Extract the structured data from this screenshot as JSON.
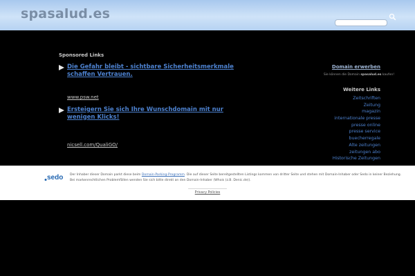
{
  "header": {
    "site_title": "spasalud.es",
    "search": {
      "value": "",
      "placeholder": ""
    }
  },
  "ads": {
    "title": "Sponsored Links",
    "items": [
      {
        "headline": "Die Gefahr bleibt - sichtbare Sicherheitsmerkmale schaffen Vertrauen.",
        "url": "www.psw.net"
      },
      {
        "headline": "Ersteigern Sie sich Ihre Wunschdomain mit nur wenigen Klicks!",
        "url": "nicsell.com/QualiGO/"
      }
    ]
  },
  "sidebar": {
    "domain_heading": "Domain erwerben",
    "domain_text_before": "Sie können die Domain ",
    "domain_name": "spasalud.es",
    "domain_text_after": " kaufen!",
    "more_heading": "Weitere Links",
    "links": [
      "Zeitschriften",
      "Zeitung",
      "magazin",
      "internationale presse",
      "presse online",
      "presse service",
      "buecherregale",
      "Alte zeitungen",
      "zeitungen abo",
      "Historische Zeitungen"
    ]
  },
  "footer": {
    "logo_text": "sedo",
    "notice_part1": "Der Inhaber dieser Domain parkt diese beim ",
    "notice_link": "Domain-Parking-Programm",
    "notice_part2": ". Die auf dieser Seite bereitgestellten Listings kommen von dritter Seite und stehen mit Domain-Inhaber oder Sedo in keiner Beziehung.",
    "notice_line2": "Bei markenrechtlichen Problemfällen wenden Sie sich bitte direkt an den Domain-Inhaber (Whois (z.B. Denic.de)).",
    "privacy_label": "Privacy Policies"
  },
  "colors": {
    "header_bg": "#b6d2f2",
    "link_blue": "#4d82d0",
    "body_bg": "#000000"
  }
}
